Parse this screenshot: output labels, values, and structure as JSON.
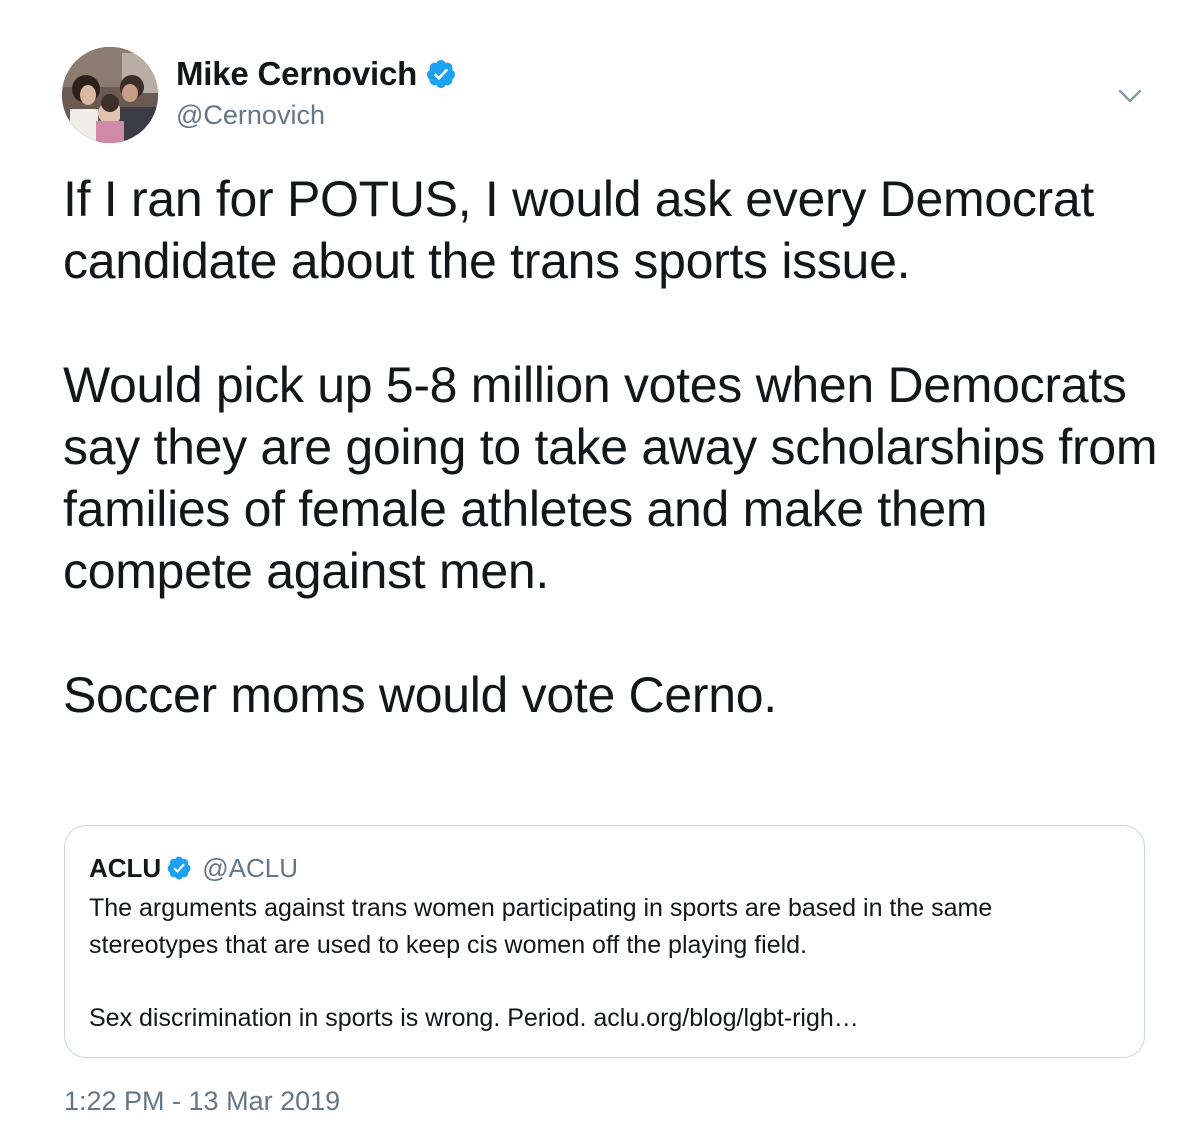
{
  "author": {
    "display_name": "Mike Cernovich",
    "handle": "@Cernovich",
    "verified_icon": "verified-badge-icon",
    "avatar_icon": "profile-photo"
  },
  "tweet": {
    "paragraphs": [
      "If I ran for POTUS, I would ask every Democrat candidate about the trans sports issue.",
      "Would pick up 5-8 million votes when Democrats say they are going to take away scholarships from families of female athletes and make them compete against men.",
      "Soccer moms would vote Cerno."
    ],
    "timestamp": "1:22 PM - 13 Mar 2019",
    "menu_icon": "chevron-down-icon"
  },
  "quote": {
    "display_name": "ACLU",
    "handle": "@ACLU",
    "paragraphs": [
      "The arguments against trans women participating in sports are based in the same stereotypes that are used to keep cis women off the playing field.",
      "Sex discrimination in sports is wrong. Period. aclu.org/blog/lgbt-righ…"
    ]
  },
  "colors": {
    "verified_blue": "#1da1f2",
    "text_primary": "#14171a",
    "text_secondary": "#657786",
    "border": "#ccd6dd"
  }
}
